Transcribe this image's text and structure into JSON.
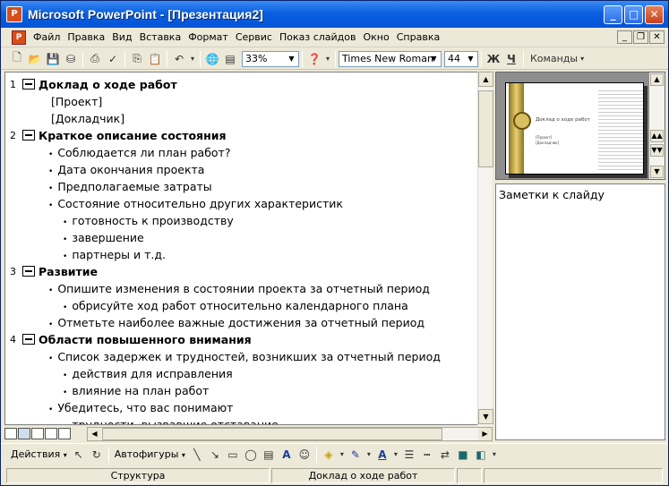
{
  "window": {
    "title": "Microsoft PowerPoint - [Презентация2]"
  },
  "menu": [
    "Файл",
    "Правка",
    "Вид",
    "Вставка",
    "Формат",
    "Сервис",
    "Показ слайдов",
    "Окно",
    "Справка"
  ],
  "toolbar": {
    "zoom": "33%",
    "font": "Times New Roman",
    "size": "44",
    "bold": "Ж",
    "underline": "Ч",
    "commands": "Команды"
  },
  "outline": {
    "slides": [
      {
        "num": "1",
        "title": "Доклад о ходе работ",
        "items": [
          {
            "text": "[Проект]",
            "level": 0
          },
          {
            "text": "[Докладчик]",
            "level": 0
          }
        ]
      },
      {
        "num": "2",
        "title": "Краткое описание состояния",
        "items": [
          {
            "text": "Соблюдается ли план работ?",
            "level": 1
          },
          {
            "text": "Дата окончания проекта",
            "level": 1
          },
          {
            "text": "Предполагаемые затраты",
            "level": 1
          },
          {
            "text": "Состояние относительно других характеристик",
            "level": 1
          },
          {
            "text": "готовность к производству",
            "level": 2
          },
          {
            "text": "завершение",
            "level": 2
          },
          {
            "text": "партнеры и т.д.",
            "level": 2
          }
        ]
      },
      {
        "num": "3",
        "title": "Развитие",
        "items": [
          {
            "text": "Опишите изменения в состоянии проекта за отчетный период",
            "level": 1
          },
          {
            "text": "обрисуйте ход работ относительно календарного плана",
            "level": 2
          },
          {
            "text": "Отметьте наиболее важные достижения за отчетный период",
            "level": 1
          }
        ]
      },
      {
        "num": "4",
        "title": "Области повышенного внимания",
        "items": [
          {
            "text": "Список задержек и трудностей, возникших за отчетный период",
            "level": 1
          },
          {
            "text": "действия для исправления",
            "level": 2
          },
          {
            "text": "влияние на план работ",
            "level": 2
          },
          {
            "text": "Убедитесь, что вас понимают",
            "level": 1
          },
          {
            "text": "трудности, вызвавшие отставание",
            "level": 2
          }
        ]
      }
    ]
  },
  "preview": {
    "title": "Доклад о ходе работ",
    "sub1": "[Проект]",
    "sub2": "[Докладчик]"
  },
  "notes": {
    "placeholder": "Заметки к слайду"
  },
  "drawing": {
    "actions": "Действия",
    "autoshapes": "Автофигуры"
  },
  "status": {
    "view": "Структура",
    "design": "Доклад о ходе работ"
  }
}
